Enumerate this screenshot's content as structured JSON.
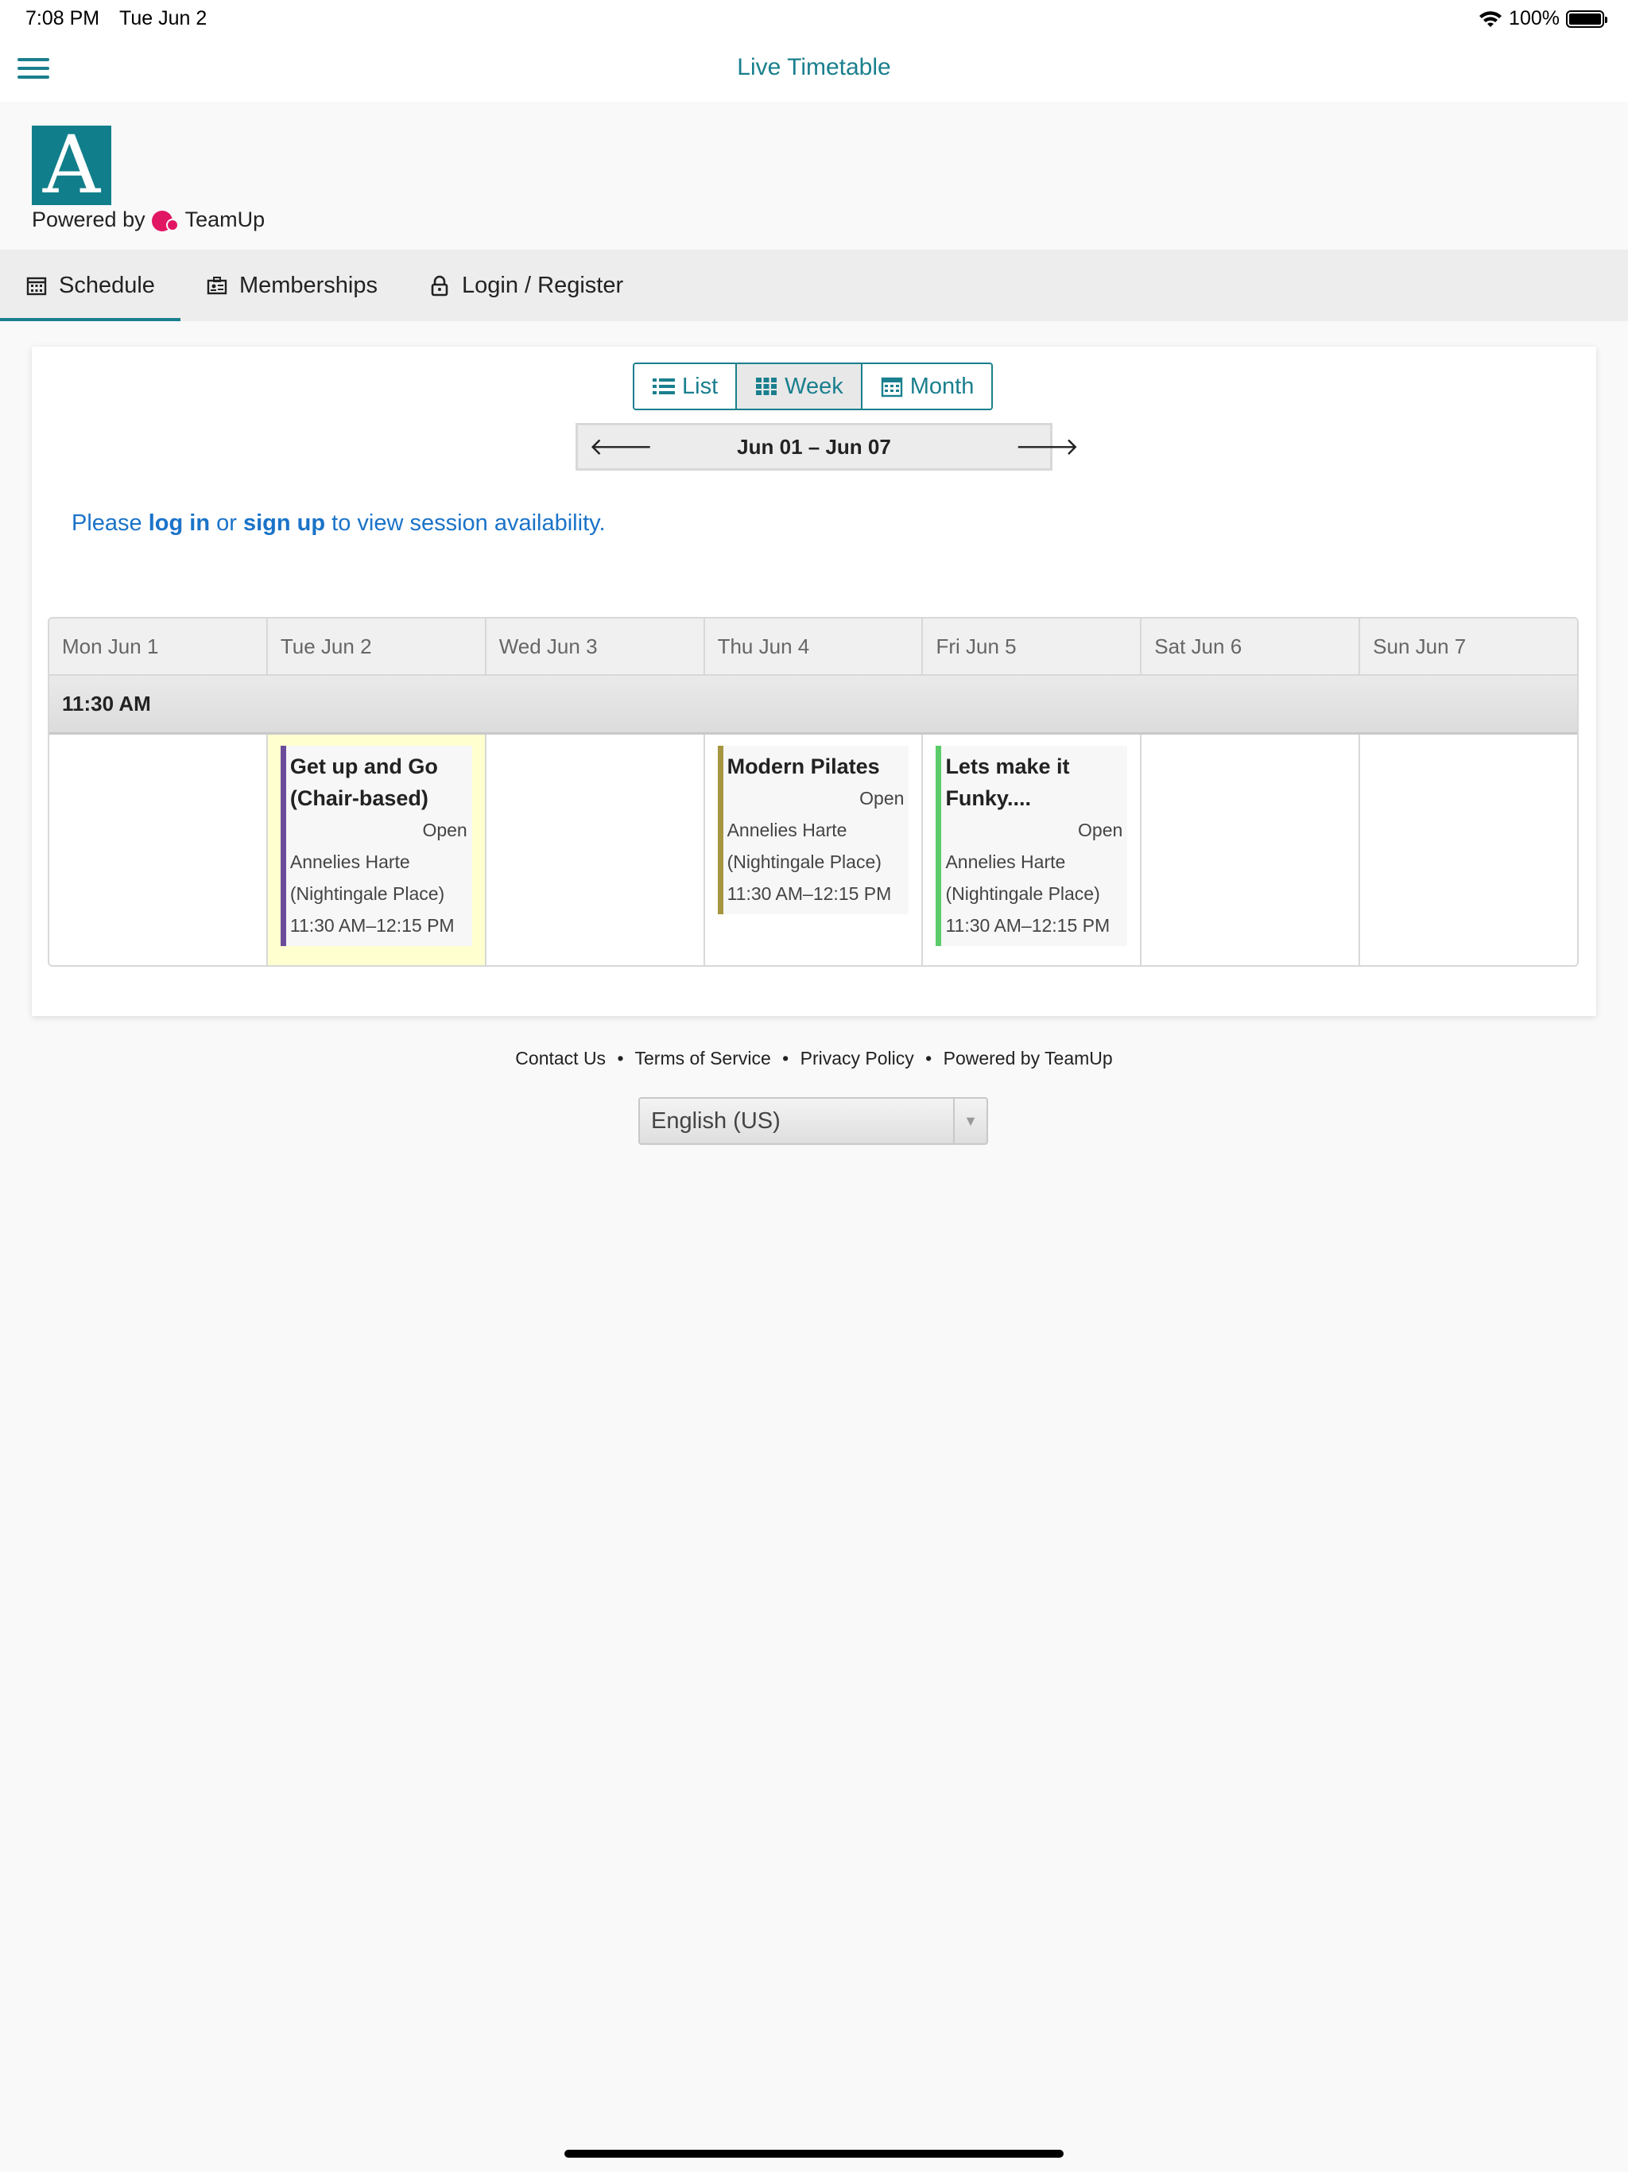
{
  "status_bar": {
    "time": "7:08 PM",
    "date": "Tue Jun 2",
    "battery": "100%",
    "battery_level": 1.0
  },
  "navbar": {
    "title": "Live Timetable",
    "menu_icon": "hamburger-menu-icon"
  },
  "brand": {
    "logo_letter": "A",
    "logo_color": "#117f8b",
    "powered_by": "Powered by",
    "teamup": "TeamUp"
  },
  "tabs": [
    {
      "label": "Schedule",
      "icon": "calendar-icon",
      "active": true
    },
    {
      "label": "Memberships",
      "icon": "id-card-icon",
      "active": false
    },
    {
      "label": "Login / Register",
      "icon": "lock-icon",
      "active": false
    }
  ],
  "view_switch": {
    "list": "List",
    "week": "Week",
    "month": "Month",
    "selected": "Week"
  },
  "range_nav": {
    "label": "Jun 01 – Jun 07",
    "prev_icon": "arrow-left-icon",
    "next_icon": "arrow-right-icon"
  },
  "notice": {
    "pre": "Please ",
    "login": "log in",
    "mid": " or ",
    "signup": "sign up",
    "post": " to view session availability."
  },
  "grid": {
    "days": [
      "Mon Jun 1",
      "Tue Jun 2",
      "Wed Jun 3",
      "Thu Jun 4",
      "Fri Jun 5",
      "Sat Jun 6",
      "Sun Jun 7"
    ],
    "time_label": "11:30 AM",
    "sessions": {
      "tue": {
        "title_1": "Get up and Go",
        "title_2": "(Chair-based)",
        "status": "Open",
        "instructor": "Annelies Harte",
        "location": "(Nightingale Place)",
        "time": "11:30 AM–12:15 PM",
        "color": "#6b4c9a"
      },
      "thu": {
        "title_1": "Modern Pilates",
        "status": "Open",
        "instructor": "Annelies Harte",
        "location": "(Nightingale Place)",
        "time": "11:30 AM–12:15 PM",
        "color": "#a69640"
      },
      "fri": {
        "title_1": "Lets make it",
        "title_2": "Funky....",
        "status": "Open",
        "instructor": "Annelies Harte",
        "location": "(Nightingale Place)",
        "time": "11:30 AM–12:15 PM",
        "color": "#5ccc6a"
      }
    }
  },
  "footer": {
    "links": [
      "Contact Us",
      "Terms of Service",
      "Privacy Policy",
      "Powered by TeamUp"
    ],
    "separator": "•",
    "language": "English (US)"
  },
  "colors": {
    "accent": "#1a7f8e",
    "link": "#1a73c8",
    "today_highlight": "#ffffd0"
  }
}
